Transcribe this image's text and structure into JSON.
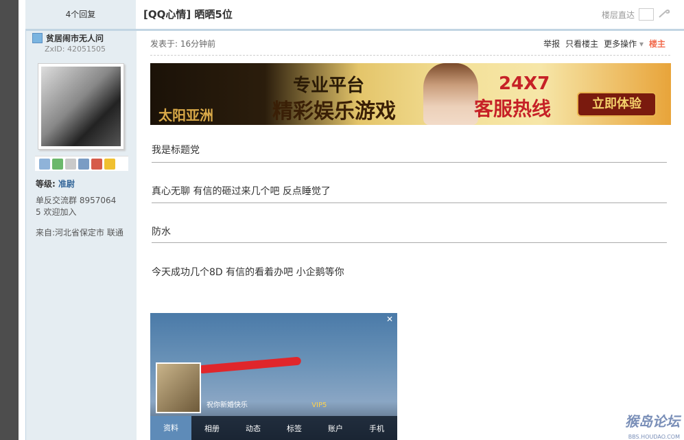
{
  "header": {
    "reply_count": "4个回复",
    "thread_title": "[QQ心情] 晒晒5位",
    "jump_label": "楼层直达"
  },
  "user": {
    "name": "贫居闹市无人问",
    "uid": "ZxID:  42051505",
    "rank_label": "等级:",
    "rank_value": "准尉",
    "signature_line1": "单反交流群 8957064",
    "signature_line2": "5  欢迎加入",
    "from": "来自:河北省保定市 联通"
  },
  "post_meta": {
    "posted": "发表于: 16分钟前",
    "actions": [
      "举报",
      "只看楼主",
      "更多操作"
    ],
    "op_label": "楼主"
  },
  "banner": {
    "brand": "太阳亚洲",
    "line1": "专业平台",
    "line2": "精彩娱乐游戏",
    "hotline_top": "24X7",
    "hotline_bottom": "客服热线",
    "cta": "立即体验"
  },
  "post": {
    "lines": [
      "我是标题党",
      "真心无聊 有信的砸过来几个吧 反点睡觉了",
      "防水",
      "今天成功几个8D  有信的看着办吧 小企鹅等你"
    ]
  },
  "screenshot": {
    "status_text": "祝你新婚快乐",
    "vip": "VIP5",
    "nav": [
      "资料",
      "相册",
      "动态",
      "标签",
      "账户",
      "手机"
    ]
  },
  "watermark": {
    "brand": "猴岛论坛",
    "url": "BBS.HOUDAO.COM"
  },
  "colors": {
    "side_bg": "#e5edf2",
    "accent_blue": "#336699",
    "op_orange": "#f26c4f",
    "border": "#c2d5e3"
  }
}
